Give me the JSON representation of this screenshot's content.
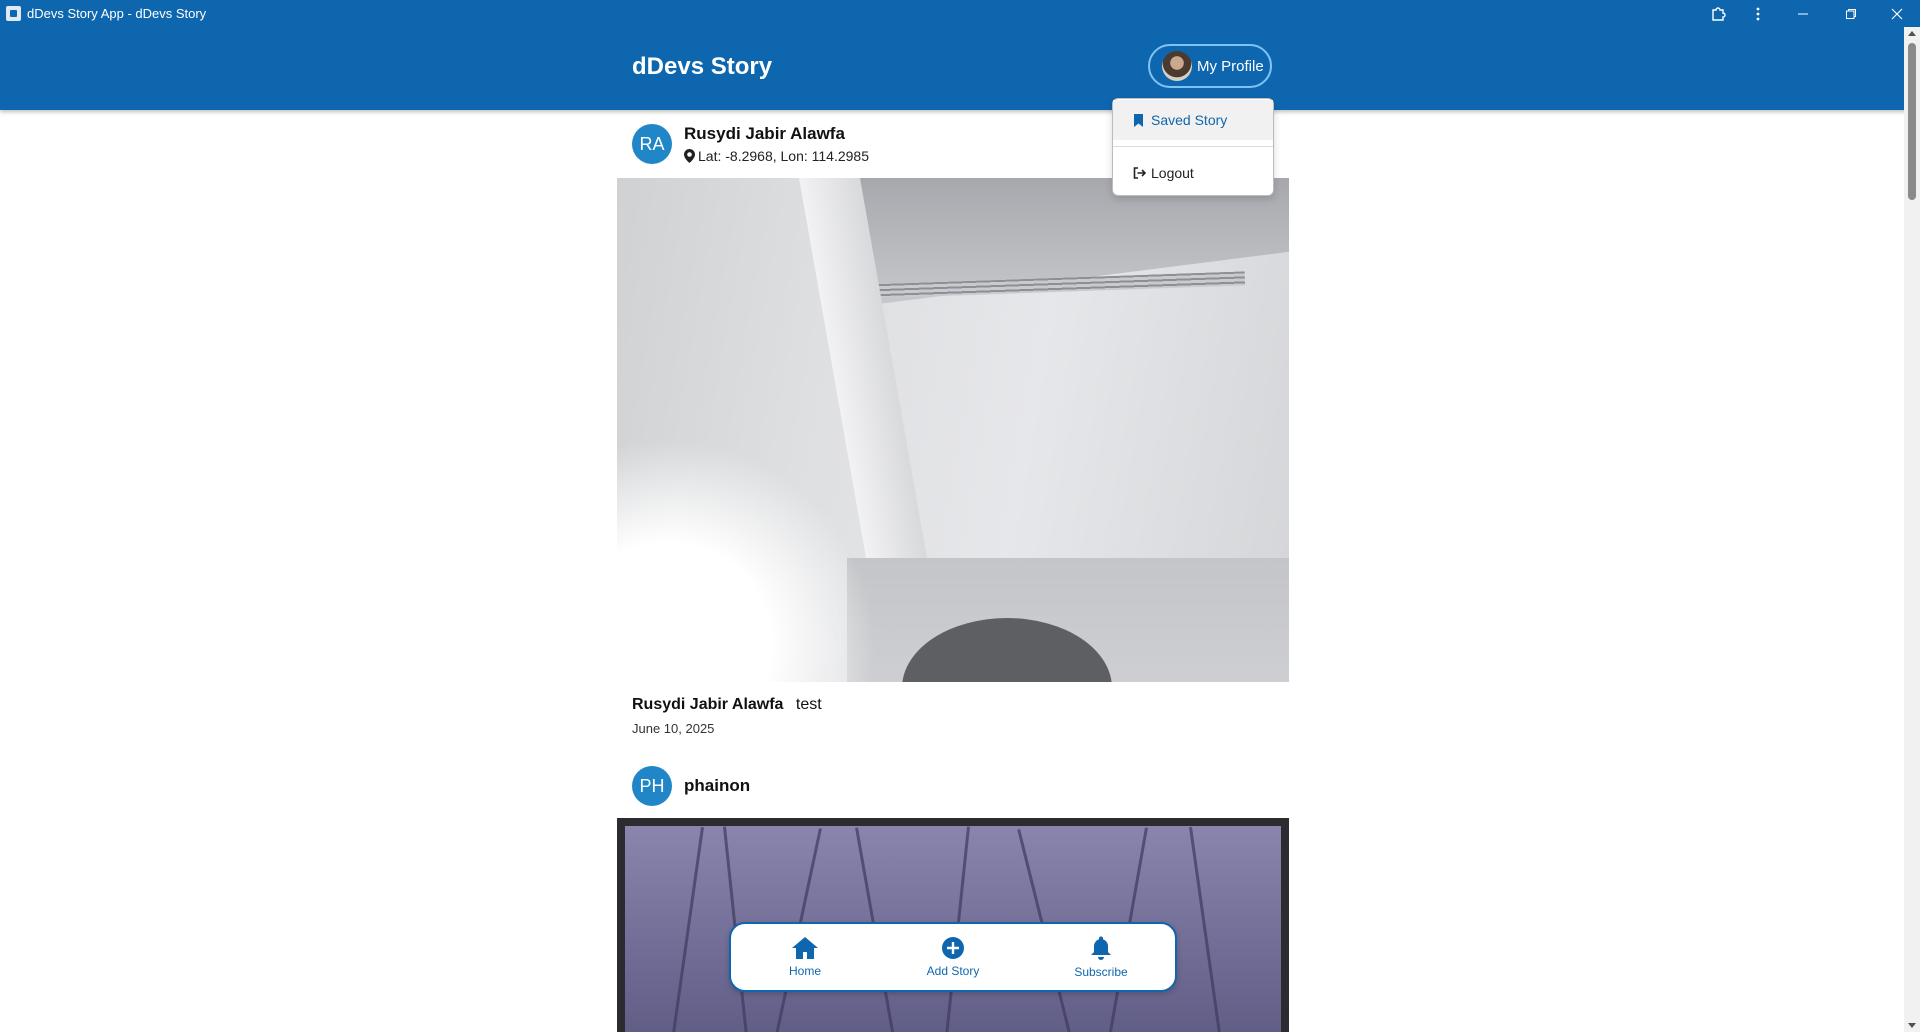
{
  "window": {
    "title": "dDevs Story App - dDevs Story",
    "controls": [
      "extensions-icon",
      "more-icon",
      "minimize-icon",
      "maximize-icon",
      "close-icon"
    ]
  },
  "header": {
    "brand": "dDevs Story",
    "profile_button": "My Profile"
  },
  "profile_menu": {
    "items": [
      {
        "label": "Saved Story",
        "icon": "bookmark-icon",
        "active": true
      },
      {
        "label": "Logout",
        "icon": "logout-icon",
        "active": false
      }
    ]
  },
  "stories": [
    {
      "initials": "RA",
      "user": "Rusydi Jabir Alawfa",
      "location": "Lat: -8.2968, Lon: 114.2985",
      "caption": "test",
      "date": "June 10, 2025"
    },
    {
      "initials": "PH",
      "user": "phainon"
    }
  ],
  "bottom_nav": {
    "items": [
      {
        "label": "Home",
        "icon": "home-icon"
      },
      {
        "label": "Add Story",
        "icon": "add-circle-icon"
      },
      {
        "label": "Subscribe",
        "icon": "bell-icon"
      }
    ]
  },
  "colors": {
    "primary": "#0e67ae",
    "avatar": "#2186c7",
    "profile_border": "#7ec3f5"
  }
}
